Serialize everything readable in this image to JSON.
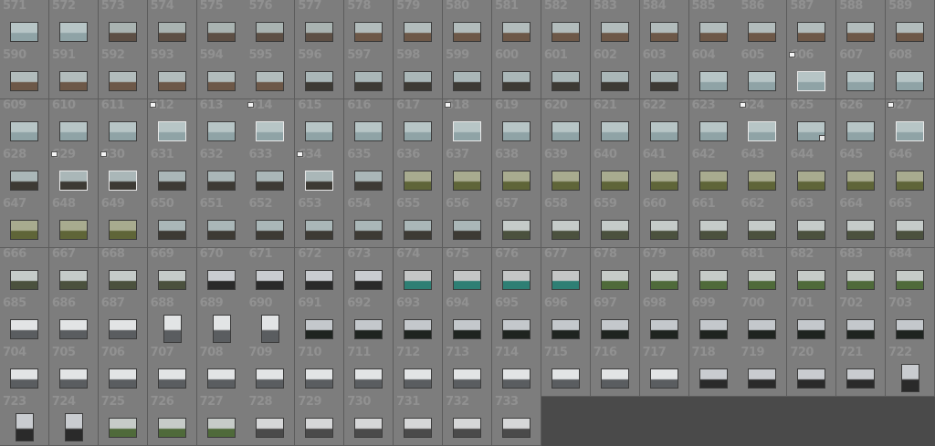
{
  "app": {
    "view": "Library Grid"
  },
  "grid": {
    "first_number": 571,
    "last_number": 733,
    "columns": 19,
    "flagged": [
      606,
      612,
      614,
      618,
      624,
      627,
      629,
      630,
      634
    ],
    "badged": [
      625
    ],
    "portrait": [
      688,
      689,
      690,
      722,
      723,
      724
    ],
    "ranges": [
      {
        "from": 571,
        "to": 572,
        "style": "sea"
      },
      {
        "from": 573,
        "to": 577,
        "style": "rocks"
      },
      {
        "from": 578,
        "to": 595,
        "style": "shore"
      },
      {
        "from": 596,
        "to": 603,
        "style": "coast"
      },
      {
        "from": 604,
        "to": 627,
        "style": "sea"
      },
      {
        "from": 628,
        "to": 635,
        "style": "coast"
      },
      {
        "from": 636,
        "to": 649,
        "style": "flowers"
      },
      {
        "from": 650,
        "to": 656,
        "style": "coast"
      },
      {
        "from": 657,
        "to": 669,
        "style": "trees"
      },
      {
        "from": 670,
        "to": 673,
        "style": "chimney"
      },
      {
        "from": 674,
        "to": 677,
        "style": "teal"
      },
      {
        "from": 678,
        "to": 684,
        "style": "grass"
      },
      {
        "from": 685,
        "to": 690,
        "style": "building"
      },
      {
        "from": 691,
        "to": 703,
        "style": "dark"
      },
      {
        "from": 704,
        "to": 717,
        "style": "building"
      },
      {
        "from": 718,
        "to": 724,
        "style": "chimney"
      },
      {
        "from": 725,
        "to": 727,
        "style": "grass"
      },
      {
        "from": 728,
        "to": 733,
        "style": "fence"
      }
    ],
    "palettes": {
      "sea": [
        "#b7c5c6",
        "#8fa3a6"
      ],
      "rocks": [
        "#a9b3b1",
        "#5d4f45"
      ],
      "shore": [
        "#b2bcbc",
        "#6d5848"
      ],
      "coast": [
        "#aab7b8",
        "#3d3a34"
      ],
      "flowers": [
        "#a8ab8f",
        "#5f6538"
      ],
      "trees": [
        "#c5cbc9",
        "#4b513e"
      ],
      "chimney": [
        "#c9ccd0",
        "#2a2a2a"
      ],
      "teal": [
        "#c4c6c6",
        "#2e7f74"
      ],
      "grass": [
        "#c6cbc8",
        "#4f6a3a"
      ],
      "building": [
        "#e2e4e5",
        "#5a5d60"
      ],
      "dark": [
        "#c4c8cc",
        "#1f2420"
      ],
      "fence": [
        "#d6d7d8",
        "#4a4a4a"
      ]
    }
  }
}
